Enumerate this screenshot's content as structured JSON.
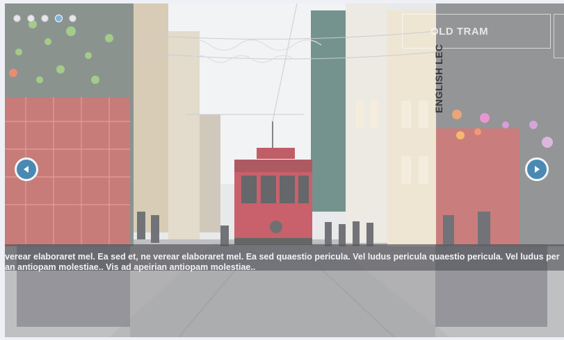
{
  "slider": {
    "dots_count": 5,
    "active_dot_index": 3,
    "prev_label": "Previous slide",
    "next_label": "Next slide"
  },
  "tiles": {
    "title": "OLD TRAM",
    "vertical_label": "ENGLISH LEC"
  },
  "caption": {
    "line1": "verear elaboraret mel. Ea sed et, ne verear elaboraret mel. Ea sed quaestio pericula. Vel ludus pericula quaestio pericula. Vel ludus per",
    "line2": "an antiopam molestiae.. Vis ad apeirian antiopam molestiae.."
  },
  "colors": {
    "arrow_fill": "#4a89b4",
    "active_dot": "#7fb3dc",
    "caption_band": "#46464c"
  }
}
